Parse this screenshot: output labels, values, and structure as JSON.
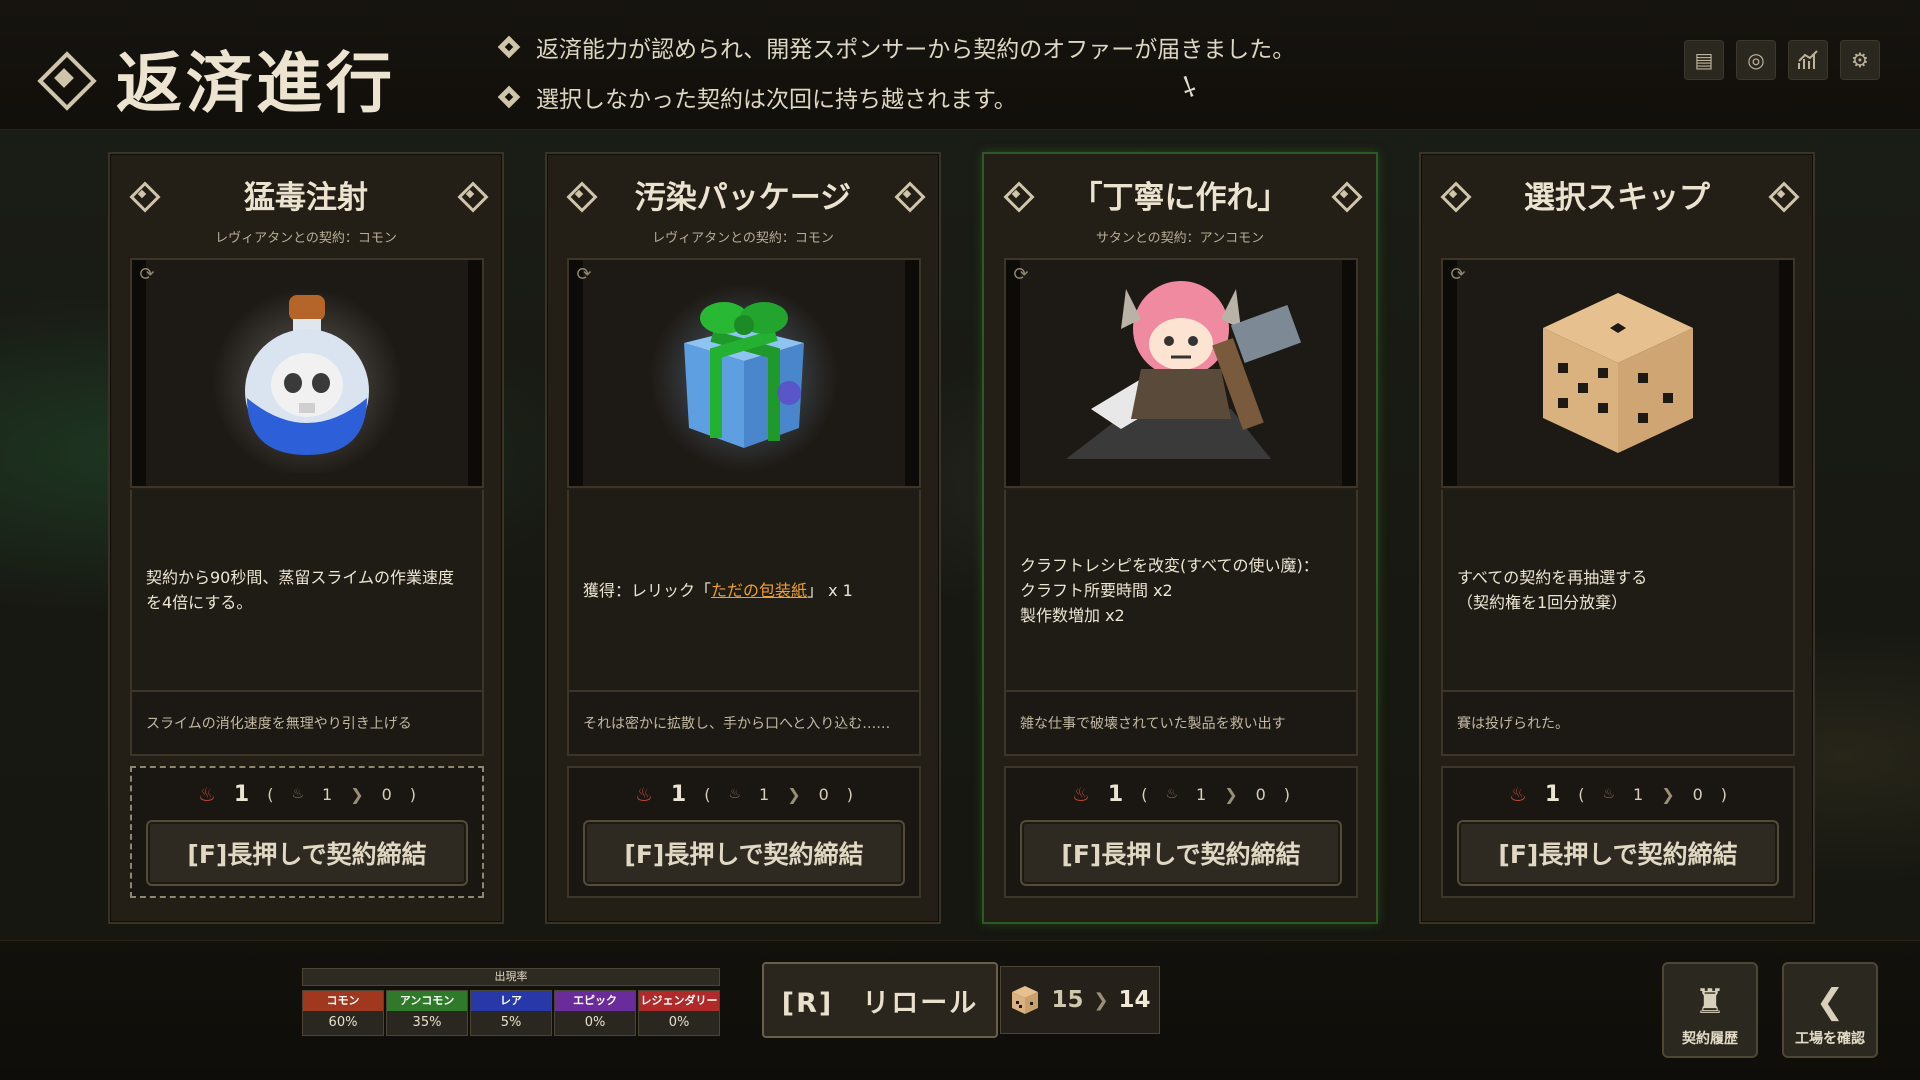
{
  "header": {
    "title": "返済進行",
    "notices": [
      "返済能力が認められ、開発スポンサーから契約のオファーが届きました。",
      "選択しなかった契約は次回に持ち越されます。"
    ]
  },
  "top_icons": [
    "book-icon",
    "target-icon",
    "chart-icon",
    "gear-icon"
  ],
  "cards": [
    {
      "title": "猛毒注射",
      "subtitle": "レヴィアタンとの契約：コモン",
      "image": "poison-flask-skull",
      "desc": "契約から90秒間、蒸留スライムの作業速度を4倍にする。",
      "flavor": "スライムの消化速度を無理やり引き上げる",
      "cost": "1",
      "cost_a": "1",
      "cost_b": "0",
      "button": "[F]長押しで契約締結"
    },
    {
      "title": "汚染パッケージ",
      "subtitle": "レヴィアタンとの契約：コモン",
      "image": "gift-box",
      "desc_pre": "獲得：レリック「",
      "desc_link": "ただの包装紙",
      "desc_post": "」 x 1",
      "flavor": "それは密かに拡散し、手から口へと入り込む……",
      "cost": "1",
      "cost_a": "1",
      "cost_b": "0",
      "button": "[F]長押しで契約締結"
    },
    {
      "title": "「丁寧に作れ」",
      "subtitle": "サタンとの契約：アンコモン",
      "image": "demon-girl-anvil",
      "desc_lines": [
        "クラフトレシピを改変(すべての使い魔)：",
        "クラフト所要時間 x2",
        "製作数増加 x2"
      ],
      "flavor": "雑な仕事で破壊されていた製品を救い出す",
      "cost": "1",
      "cost_a": "1",
      "cost_b": "0",
      "button": "[F]長押しで契約締結"
    },
    {
      "title": "選択スキップ",
      "subtitle": "",
      "image": "dice",
      "desc_lines": [
        "すべての契約を再抽選する",
        "（契約権を1回分放棄）"
      ],
      "flavor": "賽は投げられた。",
      "cost": "1",
      "cost_a": "1",
      "cost_b": "0",
      "button": "[F]長押しで契約締結"
    }
  ],
  "rates": {
    "title": "出現率",
    "items": [
      {
        "label": "コモン",
        "value": "60%",
        "color": "#a0371f"
      },
      {
        "label": "アンコモン",
        "value": "35%",
        "color": "#2e7a2a"
      },
      {
        "label": "レア",
        "value": "5%",
        "color": "#2838a8"
      },
      {
        "label": "エピック",
        "value": "0%",
        "color": "#6a2c9a"
      },
      {
        "label": "レジェンダリー",
        "value": "0%",
        "color": "#b02a2a"
      }
    ]
  },
  "reroll": {
    "label": "[R]　リロール",
    "from": "15",
    "to": "14"
  },
  "side_buttons": {
    "history": "契約履歴",
    "factory": "工場を確認"
  }
}
